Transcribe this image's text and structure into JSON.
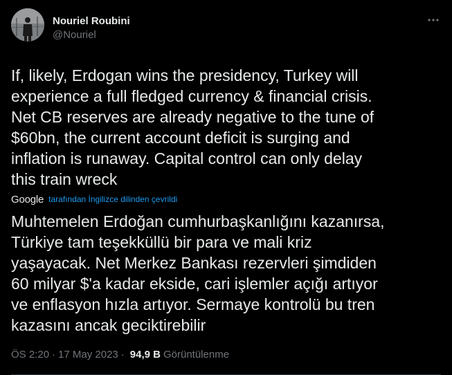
{
  "tweet": {
    "author": {
      "display_name": "Nouriel Roubini",
      "handle": "@Nouriel",
      "avatar": "avatar-photo"
    },
    "more_icon": "more-horizontal-icon",
    "text": "If, likely, Erdogan wins the presidency, Turkey will\nexperience a full fledged currency & financial crisis.\nNet CB reserves are already negative to the tune of\n$60bn, the current account deficit is surging and\ninflation is runaway. Capital control can only delay\nthis train wreck",
    "translation": {
      "provider": "Google",
      "note": "tarafından İngilizce dilinden çevrildi",
      "text": "Muhtemelen Erdoğan cumhurbaşkanlığını kazanırsa,\nTürkiye tam teşekküllü bir para ve mali kriz\nyaşayacak. Net Merkez Bankası rezervleri şimdiden\n60 milyar $'a kadar ekside, cari işlemler açığı artıyor\nve enflasyon hızla artıyor. Sermaye kontrolü bu tren\nkazasını ancak geciktirebilir"
    },
    "meta": {
      "time": "ÖS 2:20",
      "separator": "·",
      "date": "17 May 2023",
      "views_count": "94,9 B",
      "views_label": "Görüntülenme"
    }
  },
  "colors": {
    "background": "#000000",
    "text_primary": "#e7e9ea",
    "text_secondary": "#71767b",
    "link": "#1d9bf0"
  }
}
